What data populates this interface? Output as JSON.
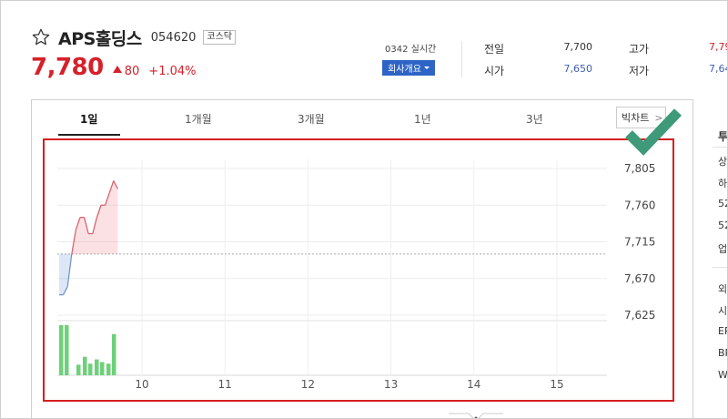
{
  "stock": {
    "name": "APS홀딩스",
    "code": "054620",
    "market": "코스닥",
    "price": "7,780",
    "change": "80",
    "change_pct": "+1.04%"
  },
  "header": {
    "realtime": "0342 실시간",
    "company_button": "회사개요"
  },
  "quote": {
    "prev_close_label": "전일",
    "prev_close": "7,700",
    "open_label": "시가",
    "open": "7,650",
    "high_label": "고가",
    "high": "7,79",
    "low_label": "저가",
    "low": "7,64"
  },
  "colors": {
    "up": "#d6202a",
    "down": "#3f5fb0",
    "volume": "#6ed07a",
    "highlight_box": "#d61e1e",
    "check": "#3e9a78"
  },
  "tabs": [
    {
      "label": "1일",
      "active": true
    },
    {
      "label": "1개월",
      "active": false
    },
    {
      "label": "3개월",
      "active": false
    },
    {
      "label": "1년",
      "active": false
    },
    {
      "label": "3년",
      "active": false
    }
  ],
  "big_chart_label": "빅차트",
  "right_panel": [
    "투",
    "상",
    "하",
    "52",
    "52",
    "업",
    "외",
    "시",
    "EP",
    "BP",
    "W"
  ],
  "chart_data": {
    "type": "line",
    "x_ticks": [
      "10",
      "11",
      "12",
      "13",
      "14",
      "15"
    ],
    "y_ticks": [
      "7,805",
      "7,760",
      "7,715",
      "7,670",
      "7,625"
    ],
    "ylim": [
      7625,
      7805
    ],
    "prev_close_line": 7700,
    "price": [
      7650,
      7650,
      7660,
      7700,
      7730,
      7745,
      7745,
      7725,
      7725,
      7745,
      7760,
      7760,
      7775,
      7790,
      7780
    ],
    "volume": [
      0.95,
      0.95,
      0.22,
      0.48,
      0.42,
      0.4,
      0.75,
      0.3,
      0.22,
      0.9
    ],
    "volume_bars_x_index": [
      0,
      1,
      4,
      5,
      6,
      7,
      8,
      9
    ]
  }
}
